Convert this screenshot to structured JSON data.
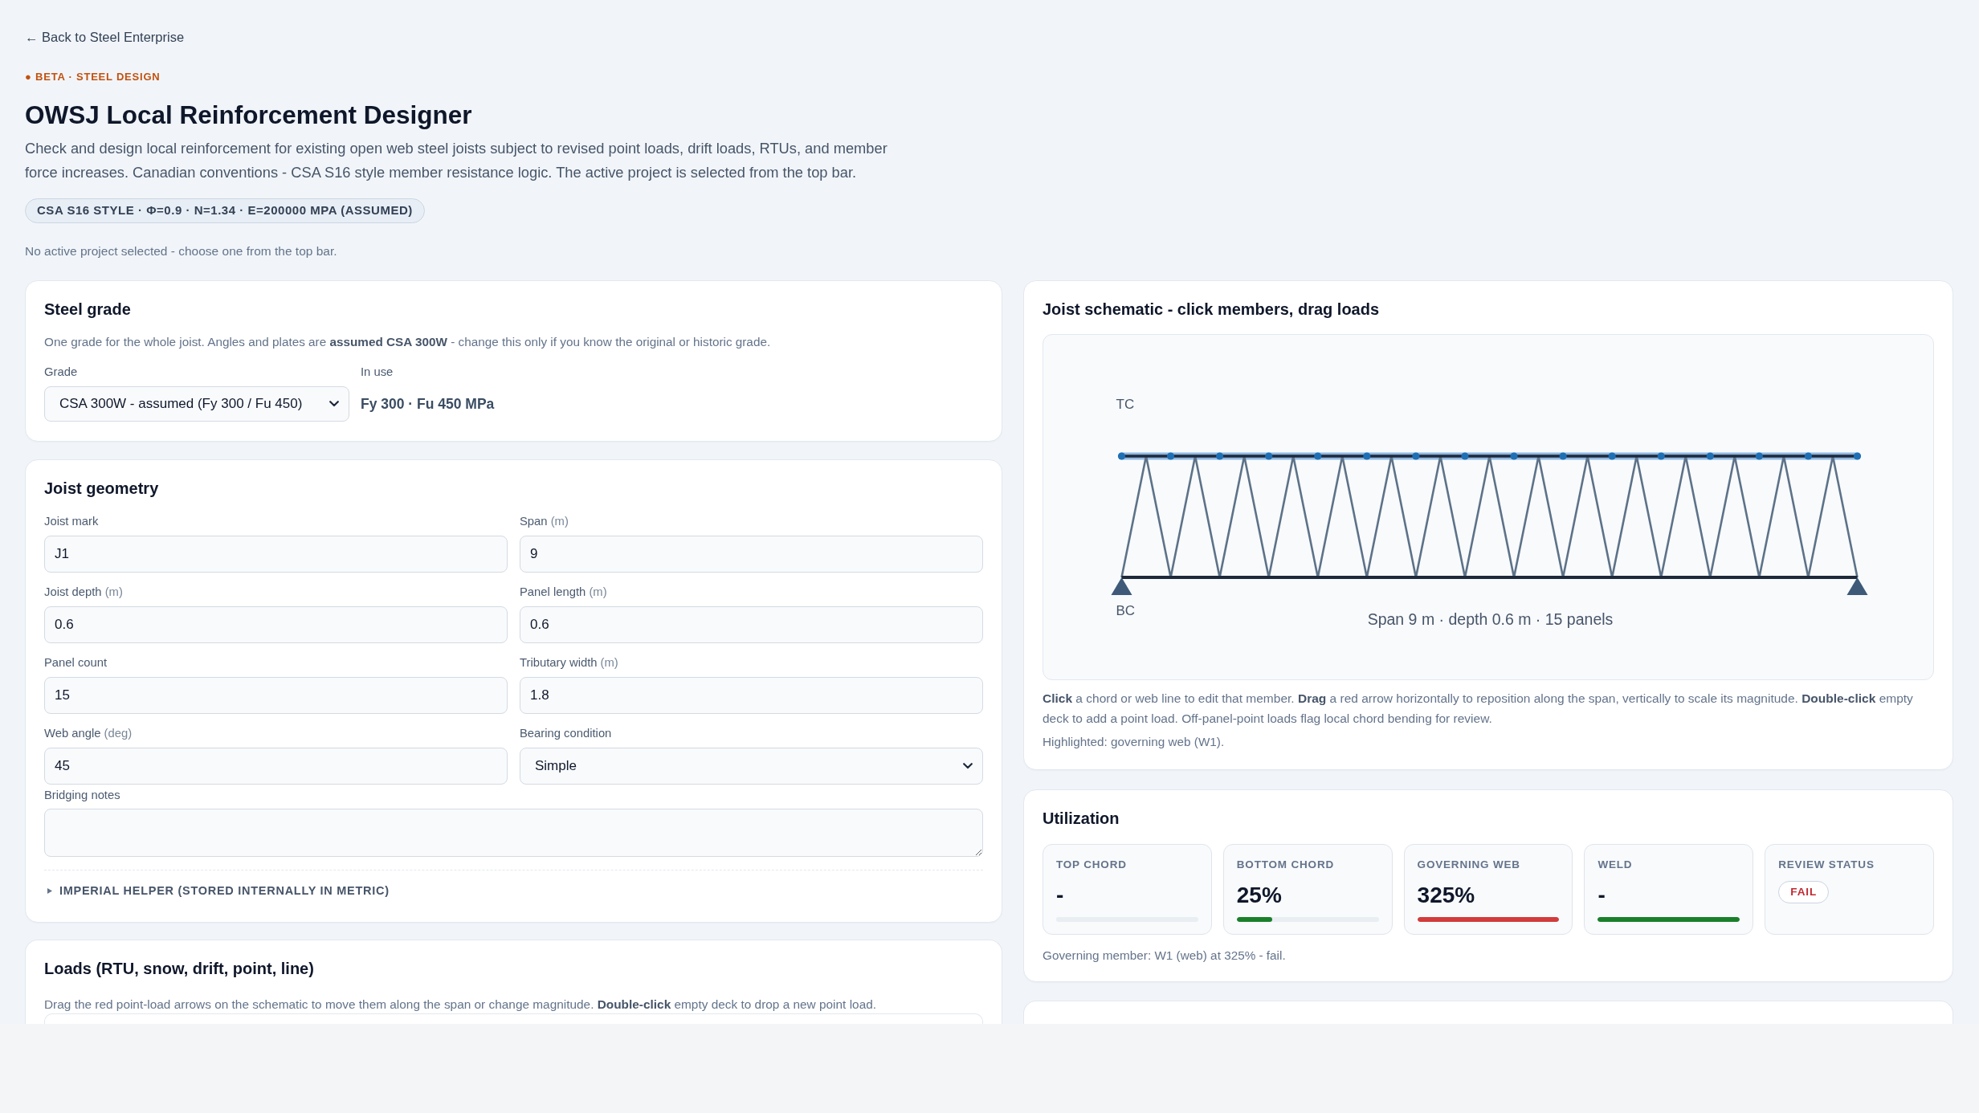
{
  "header": {
    "back_link": "← Back to Steel Enterprise",
    "eyebrow": "● BETA · STEEL DESIGN",
    "title": "OWSJ Local Reinforcement Designer",
    "description": "Check and design local reinforcement for existing open web steel joists subject to revised point loads, drift loads, RTUs, and member force increases. Canadian conventions - CSA S16 style member resistance logic. The active project is selected from the top bar.",
    "badge": "CSA S16 STYLE · Φ=0.9 · N=1.34 · E=200000 MPA (ASSUMED)",
    "notice": "No active project selected - choose one from the top bar."
  },
  "steel_grade": {
    "title": "Steel grade",
    "note": "One grade for the whole joist. Angles and plates are **assumed CSA 300W** - change this only if you know the original or historic grade.",
    "grade": {
      "label": "Grade",
      "value": "CSA 300W - assumed (Fy 300 / Fu 450)"
    },
    "in_use": {
      "label": "In use",
      "value": "Fy 300 · Fu 450 MPa"
    }
  },
  "joist_geometry": {
    "title": "Joist geometry",
    "fields": [
      {
        "kind": "input",
        "label": "Joist mark",
        "value": "J1"
      },
      {
        "kind": "input",
        "label": "Span",
        "unit": "(m)",
        "value": "9"
      },
      {
        "kind": "input",
        "label": "Joist depth",
        "unit": "(m)",
        "value": "0.6"
      },
      {
        "kind": "input",
        "label": "Panel length",
        "unit": "(m)",
        "value": "0.6"
      },
      {
        "kind": "input",
        "label": "Panel count",
        "value": "15"
      },
      {
        "kind": "input",
        "label": "Tributary width",
        "unit": "(m)",
        "value": "1.8"
      },
      {
        "kind": "input",
        "label": "Web angle",
        "unit": "(deg)",
        "value": "45"
      },
      {
        "kind": "select",
        "label": "Bearing condition",
        "value": "Simple"
      }
    ],
    "bridging_notes": {
      "label": "Bridging notes"
    },
    "imperial_helper": {
      "label": "IMPERIAL HELPER (STORED INTERNALLY IN METRIC)",
      "expanded": false
    }
  },
  "loads": {
    "title": "Loads (RTU, snow, drift, point, line)",
    "note": "Drag the red point-load arrows on the schematic to move them along the span or change magnitude. **Double-click** empty deck to drop a new point load."
  },
  "schematic": {
    "title": "Joist schematic - click members, drag loads",
    "top_label": "TC",
    "bottom_label": "BC",
    "caption": "Span 9 m · depth 0.6 m · 15 panels",
    "help": "**Click** a chord or web line to edit that member. **Drag** a red arrow horizontally to reposition along the span, vertically to scale its magnitude. **Double-click** empty deck to add a point load. Off-panel-point loads flag local chord bending for review.",
    "highlighted": "Highlighted: governing web (W1)."
  },
  "utilization": {
    "title": "Utilization",
    "tiles": [
      {
        "kind": "meter",
        "label": "TOP CHORD",
        "value": "-"
      },
      {
        "kind": "meter",
        "label": "BOTTOM CHORD",
        "value": "25%",
        "level": 0.25,
        "color": "#1a7f2a"
      },
      {
        "kind": "meter",
        "label": "GOVERNING WEB",
        "value": "325%",
        "level": 1,
        "color": "#d23c3c"
      },
      {
        "kind": "meter",
        "label": "WELD",
        "value": "-",
        "level": 1,
        "color": "#1a7f2a"
      },
      {
        "kind": "status",
        "label": "REVIEW STATUS",
        "status": "FAIL",
        "color": "#c0292f"
      }
    ],
    "summary": "Governing member: W1 (web) at 325% - fail."
  }
}
